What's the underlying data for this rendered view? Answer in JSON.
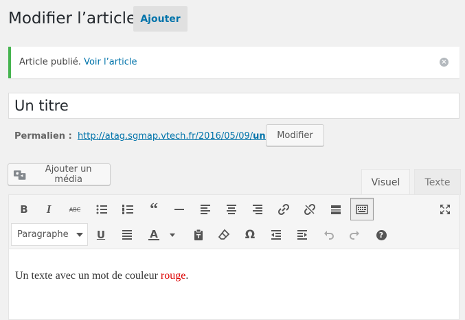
{
  "header": {
    "title": "Modifier l’article",
    "add_label": "Ajouter"
  },
  "notice": {
    "text": "Article publié.",
    "link": "Voir l’article"
  },
  "post": {
    "title": "Un titre"
  },
  "permalink": {
    "label": "Permalien :",
    "url_prefix": "http://atag.sgmap.vtech.fr/2016/05/09/",
    "slug": "un-titre",
    "url_suffix": "/",
    "modify_label": "Modifier"
  },
  "media": {
    "add_label": "Ajouter un média"
  },
  "tabs": {
    "visual": "Visuel",
    "text": "Texte"
  },
  "toolbar": {
    "format_value": "Paragraphe",
    "icons": [
      "bold-icon",
      "italic-icon",
      "strikethrough-icon",
      "bullet-list-icon",
      "numbered-list-icon",
      "blockquote-icon",
      "horizontal-rule-icon",
      "align-left-icon",
      "align-center-icon",
      "align-right-icon",
      "link-icon",
      "unlink-icon",
      "read-more-icon",
      "toolbar-toggle-icon",
      "fullscreen-icon",
      "underline-icon",
      "justify-icon",
      "text-color-icon",
      "paste-text-icon",
      "clear-formatting-icon",
      "special-character-icon",
      "outdent-icon",
      "indent-icon",
      "undo-icon",
      "redo-icon",
      "help-icon"
    ]
  },
  "content": {
    "before": "Un texte avec un mot de couleur ",
    "colored_word": "rouge",
    "after": ".",
    "accent_color": "#dd0000"
  },
  "colors": {
    "link": "#0073aa",
    "notice_border": "#46b450"
  }
}
